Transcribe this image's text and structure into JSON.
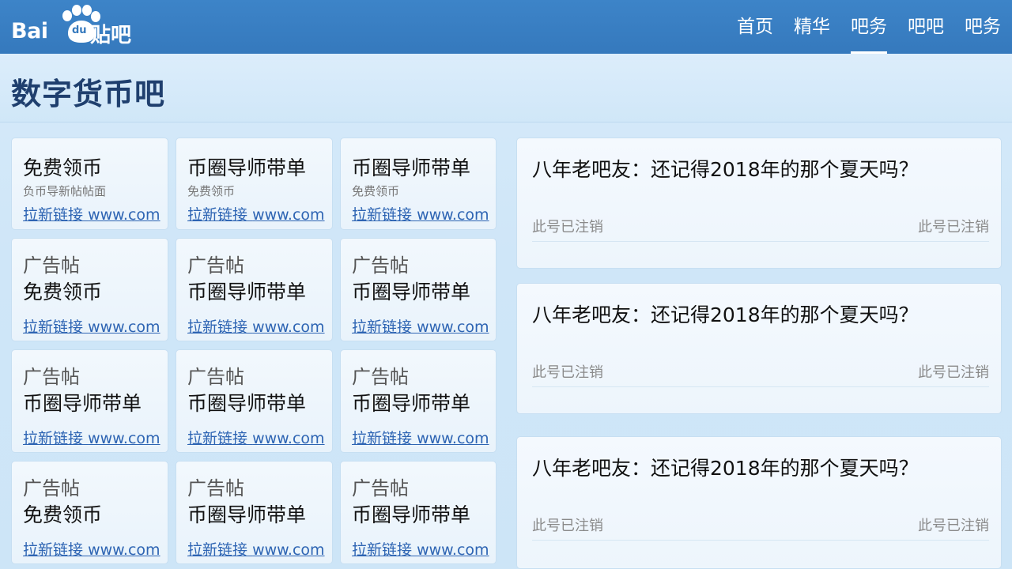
{
  "logo": {
    "brand": "Bai",
    "du": "du",
    "product": "贴吧"
  },
  "nav": {
    "items": [
      {
        "label": "首页",
        "active": false
      },
      {
        "label": "精华",
        "active": false
      },
      {
        "label": "吧务",
        "active": true
      },
      {
        "label": "吧吧",
        "active": false
      },
      {
        "label": "吧务",
        "active": false
      }
    ]
  },
  "page": {
    "title": "数字货币吧"
  },
  "ads": [
    {
      "title": "免费领币",
      "sub": "负币导新帖帖面",
      "link_label": "拉新链接",
      "link_url": "www.com"
    },
    {
      "title": "币圈导师带单",
      "sub": "免费领币",
      "link_label": "拉新链接",
      "link_url": "www.com"
    },
    {
      "title": "币圈导师带单",
      "sub": "免费领币",
      "link_label": "拉新链接",
      "link_url": "www.com"
    },
    {
      "tag": "广告帖",
      "title": "免费领币",
      "link_label": "拉新链接",
      "link_url": "www.com"
    },
    {
      "tag": "广告帖",
      "title": "币圈导师带单",
      "link_label": "拉新链接",
      "link_url": "www.com"
    },
    {
      "tag": "广告帖",
      "title": "币圈导师带单",
      "link_label": "拉新链接",
      "link_url": "www.com"
    },
    {
      "tag": "广告帖",
      "title": "币圈导师带单",
      "link_label": "拉新链接",
      "link_url": "www.com"
    },
    {
      "tag": "广告帖",
      "title": "币圈导师带单",
      "link_label": "拉新链接",
      "link_url": "www.com"
    },
    {
      "tag": "广告帖",
      "title": "币圈导师带单",
      "link_label": "拉新链接",
      "link_url": "www.com"
    },
    {
      "tag": "广告帖",
      "title": "免费领币",
      "link_label": "拉新链接",
      "link_url": "www.com"
    },
    {
      "tag": "广告帖",
      "title": "币圈导师带单",
      "link_label": "拉新链接",
      "link_url": "www.com"
    },
    {
      "tag": "广告帖",
      "title": "币圈导师带单",
      "link_label": "拉新链接",
      "link_url": "www.com"
    }
  ],
  "posts": [
    {
      "title": "八年老吧友：还记得2018年的那个夏天吗？",
      "author_left": "此号已注销",
      "author_right": "此号已注销"
    },
    {
      "title": "八年老吧友：还记得2018年的那个夏天吗？",
      "author_left": "此号已注销",
      "author_right": "此号已注销"
    },
    {
      "title": "八年老吧友：还记得2018年的那个夏天吗？",
      "author_left": "此号已注销",
      "author_right": "此号已注销"
    }
  ],
  "colors": {
    "topbar": "#3579bd",
    "title": "#1f3f6e",
    "link": "#2d64b3"
  }
}
